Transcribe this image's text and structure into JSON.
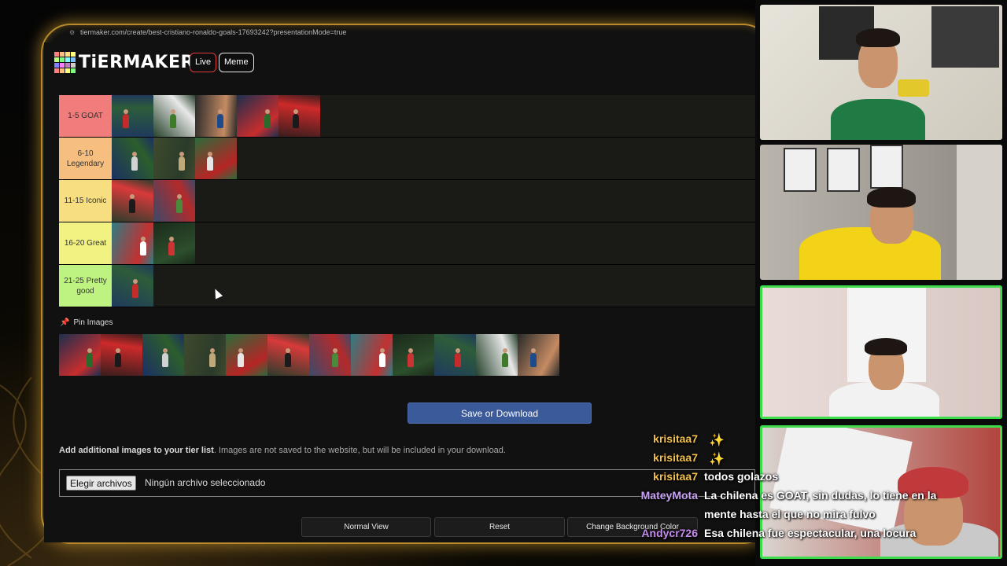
{
  "browser": {
    "url": "tiermaker.com/create/best-cristiano-ronaldo-goals-17693242?presentationMode=true"
  },
  "header": {
    "logo_text": "TiERMAKER",
    "live_label": "Live",
    "meme_label": "Meme"
  },
  "tiers": [
    {
      "label": "1-5 GOAT",
      "color": "#f07c7c",
      "items": 5
    },
    {
      "label": "6-10 Legendary",
      "color": "#f7bf7f",
      "items": 3
    },
    {
      "label": "11-15 Iconic",
      "color": "#f6de81",
      "items": 2
    },
    {
      "label": "16-20 Great",
      "color": "#f2f282",
      "items": 2
    },
    {
      "label": "21-25 Pretty good",
      "color": "#bef281",
      "items": 1
    }
  ],
  "pool": {
    "label": "Pin Images",
    "items": 12
  },
  "actions": {
    "save_label": "Save or Download",
    "add_bold": "Add additional images to your tier list",
    "add_rest": ". Images are not saved to the website, but will be included in your download.",
    "file_button": "Elegir archivos",
    "file_status": "Ningún archivo seleccionado",
    "normal_view": "Normal View",
    "reset": "Reset",
    "change_bg": "Change Background Color"
  },
  "chat": [
    {
      "user": "krisitaa7",
      "user_color": "#f2c14e",
      "message": ""
    },
    {
      "user": "krisitaa7",
      "user_color": "#f2c14e",
      "message": ""
    },
    {
      "user": "krisitaa7",
      "user_color": "#f2c14e",
      "message": "todos golazos"
    },
    {
      "user": "MateyMota",
      "user_color": "#c9a3f5",
      "message": "La chilena es GOAT, sin dudas, lo tiene en la"
    },
    {
      "user": "",
      "user_color": "#ffffff",
      "message": "mente hasta el que no mira fulvo"
    },
    {
      "user": "Andycr726",
      "user_color": "#c58cf0",
      "message": "Esa chilena fue espectacular, una locura"
    }
  ]
}
